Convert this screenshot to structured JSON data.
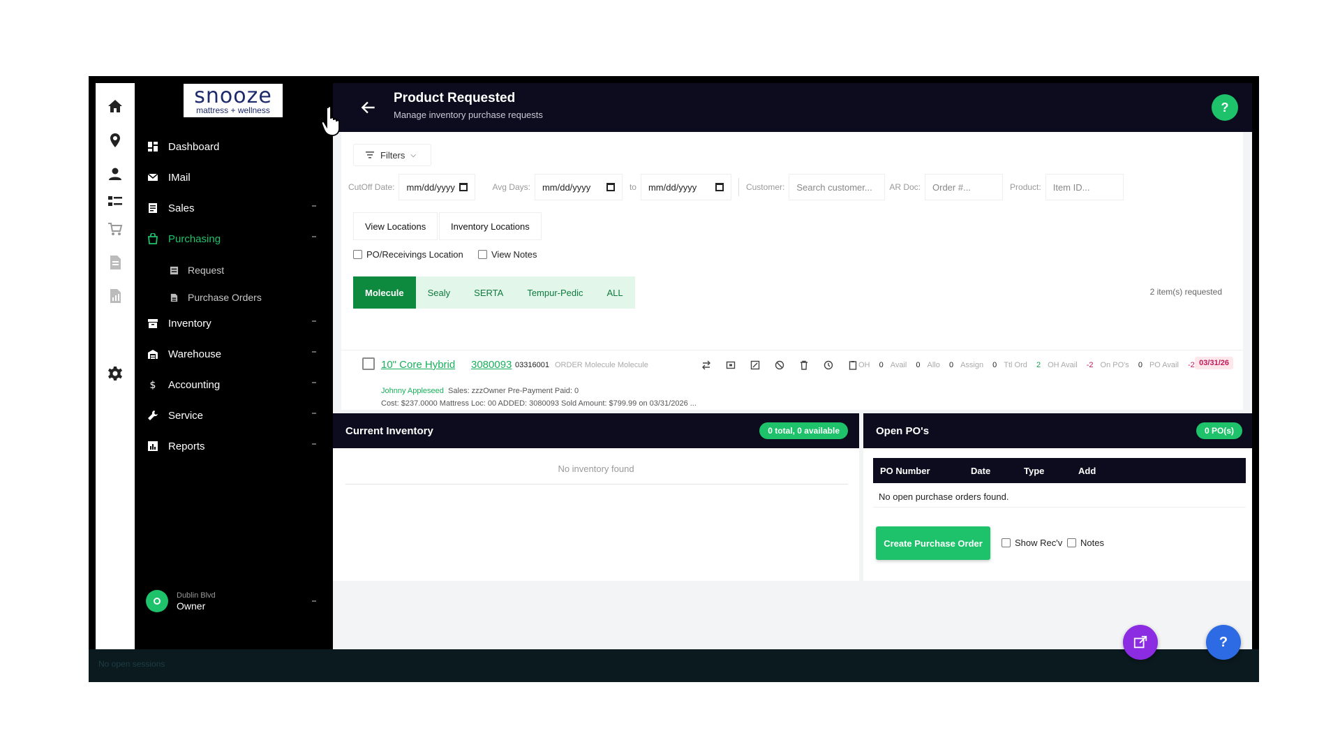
{
  "logo": {
    "line1": "snooze",
    "line2": "mattress + wellness"
  },
  "rail": {
    "icons": [
      "home-icon",
      "location-pin-icon",
      "user-icon",
      "list-icon",
      "cart-icon",
      "document-icon",
      "report-icon",
      "gear-icon"
    ]
  },
  "sidebar": {
    "items": [
      {
        "label": "Dashboard",
        "icon": "dashboard-icon"
      },
      {
        "label": "IMail",
        "icon": "mail-icon"
      },
      {
        "label": "Sales",
        "icon": "sales-icon"
      },
      {
        "label": "Purchasing",
        "icon": "bag-icon"
      },
      {
        "label": "Inventory",
        "icon": "inventory-icon"
      },
      {
        "label": "Warehouse",
        "icon": "warehouse-icon"
      },
      {
        "label": "Accounting",
        "icon": "dollar-icon"
      },
      {
        "label": "Service",
        "icon": "wrench-icon"
      },
      {
        "label": "Reports",
        "icon": "reports-icon"
      }
    ],
    "sub_items": [
      {
        "label": "Request"
      },
      {
        "label": "Purchase Orders"
      }
    ],
    "active_color": "#1ec26a",
    "user": {
      "location": "Dublin Blvd",
      "role": "Owner"
    }
  },
  "header": {
    "title": "Product Requested",
    "subtitle": "Manage inventory purchase requests",
    "help": "?"
  },
  "filters": {
    "button_label": "Filters",
    "cutoff_label": "CutOff Date:",
    "cutoff_value": "mm/dd/yyyy",
    "avg_days_label": "Avg Days:",
    "avg_from": "mm/dd/yyyy",
    "to_label": "to",
    "avg_to": "mm/dd/yyyy",
    "customer_label": "Customer:",
    "customer_placeholder": "Search customer...",
    "ar_doc_label": "AR Doc:",
    "ar_doc_placeholder": "Order #...",
    "product_label": "Product:",
    "product_placeholder": "Item ID..."
  },
  "view_buttons": {
    "locations": "View Locations",
    "inventory_locations": "Inventory Locations"
  },
  "checkboxes": {
    "po_receiving": "PO/Receivings Location",
    "view_notes": "View Notes"
  },
  "brand_tabs": [
    "Molecule",
    "Sealy",
    "SERTA",
    "Tempur-Pedic",
    "ALL"
  ],
  "request_count": "2 item(s) requested",
  "product": {
    "title": "10\" Core Hybrid",
    "sku": "3080093",
    "code": "03316001",
    "order_meta": "ORDER  Molecule  Molecule",
    "stats": [
      {
        "label": "OH",
        "value": "0",
        "tone": "normal"
      },
      {
        "label": "Avail",
        "value": "0",
        "tone": "normal"
      },
      {
        "label": "Allo",
        "value": "0",
        "tone": "normal"
      },
      {
        "label": "Assign",
        "value": "0",
        "tone": "normal"
      },
      {
        "label": "Ttl Ord",
        "value": "2",
        "tone": "green"
      },
      {
        "label": "OH Avail",
        "value": "-2",
        "tone": "red"
      },
      {
        "label": "On PO's",
        "value": "0",
        "tone": "normal"
      },
      {
        "label": "PO Avail",
        "value": "-2",
        "tone": "red"
      }
    ],
    "date_badge": "03/31/26",
    "customer": "Johnny Appleseed",
    "line2_rest": "Sales: zzzOwner  Pre-Payment  Paid: 0",
    "line3": "Cost: $237.0000  Mattress  Loc: 00  ADDED: 3080093 Sold Amount: $799.99 on 03/31/2026 ..."
  },
  "current_inventory": {
    "title": "Current Inventory",
    "badge": "0 total, 0 available",
    "empty": "No inventory found"
  },
  "open_pos": {
    "title": "Open PO's",
    "badge": "0 PO(s)",
    "columns": [
      "PO Number",
      "Date",
      "Type",
      "Add"
    ],
    "empty": "No open purchase orders found.",
    "create_button": "Create Purchase Order",
    "show_recv": "Show Rec'v",
    "notes": "Notes"
  },
  "footer": {
    "status": "No open sessions"
  },
  "fab": {
    "help": "?"
  }
}
